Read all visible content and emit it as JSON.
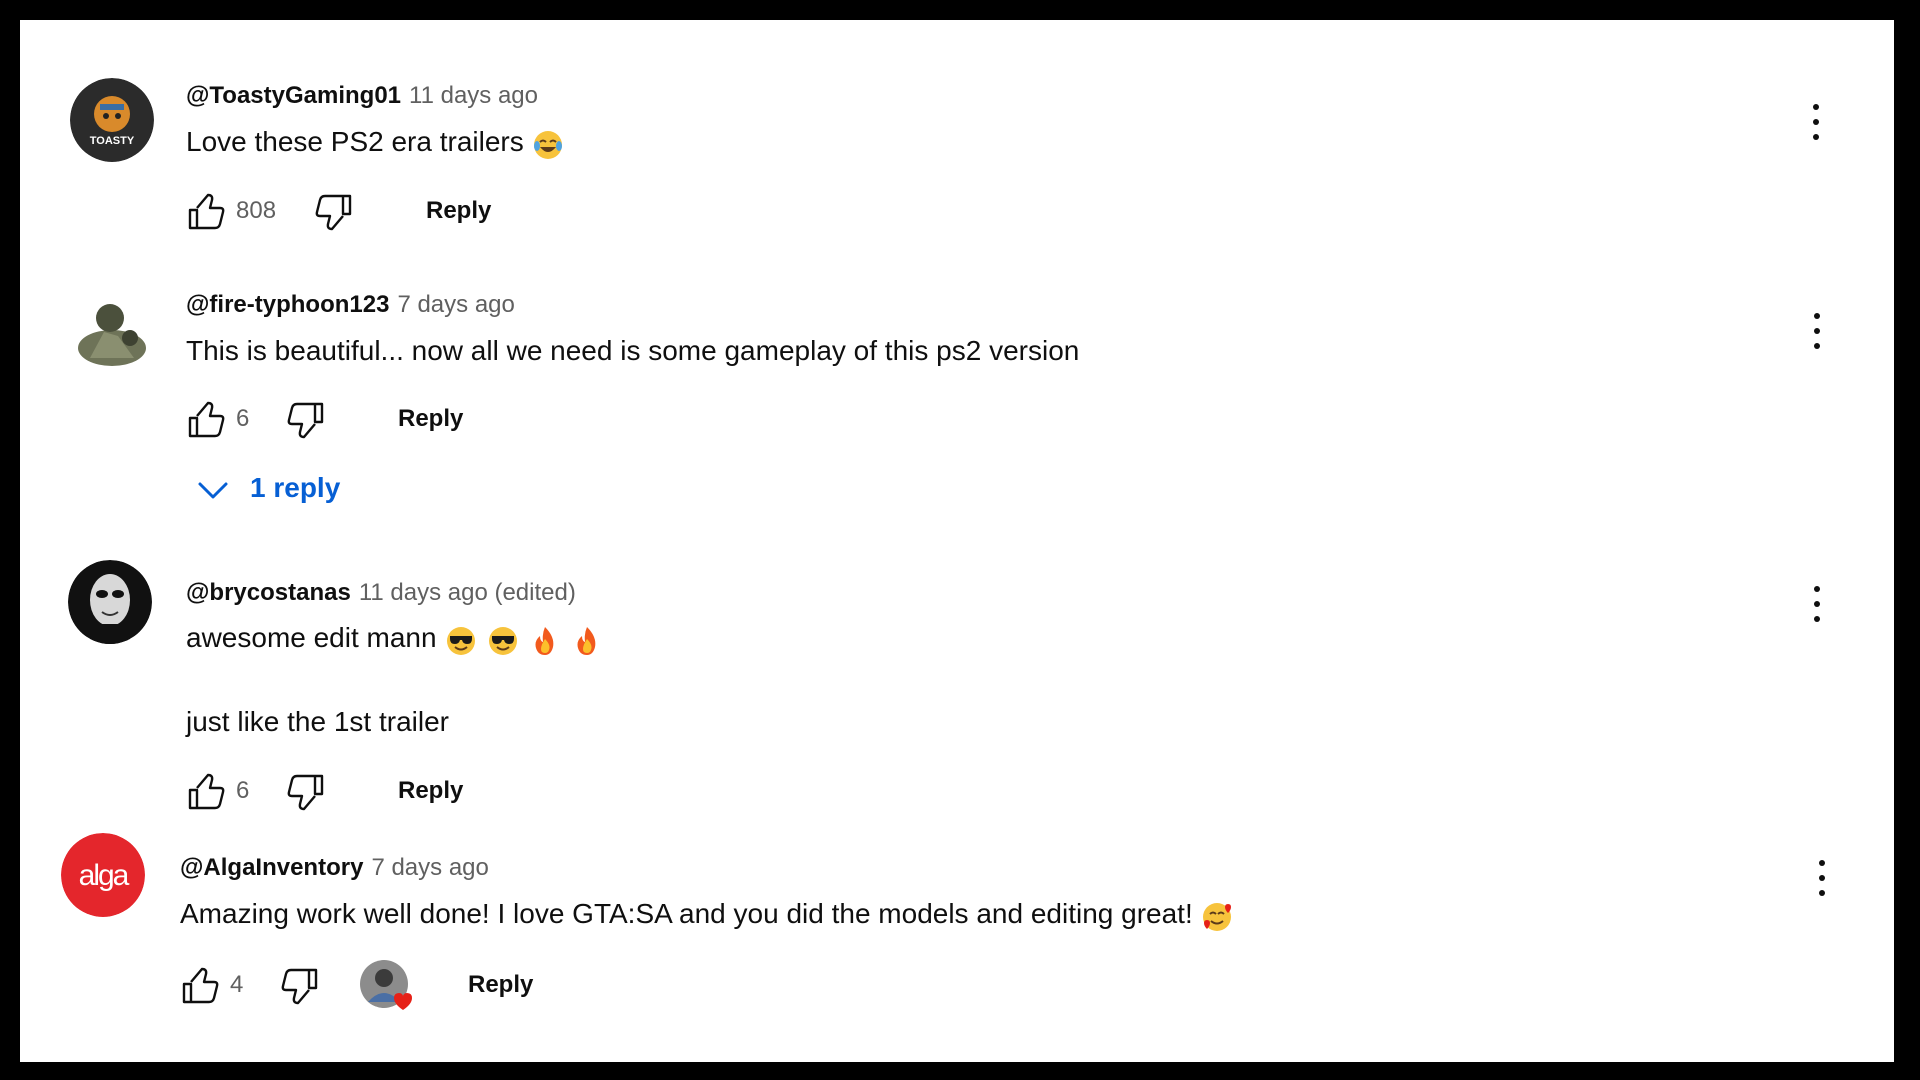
{
  "comments": [
    {
      "author": "@ToastyGaming01",
      "time": "11 days ago",
      "text": "Love these PS2 era trailers",
      "emojis": [
        "face-with-tears-of-joy"
      ],
      "likes": "808",
      "reply_label": "Reply",
      "avatar_text": "TOASTY",
      "avatar_color": "#2b2b2b"
    },
    {
      "author": "@fire-typhoon123",
      "time": "7 days ago",
      "text": "This is beautiful... now all we need is some gameplay of this ps2 version",
      "likes": "6",
      "reply_label": "Reply",
      "replies_label": "1 reply",
      "avatar_color": "#5a5f48"
    },
    {
      "author": "@brycostanas",
      "time": "11 days ago (edited)",
      "text": "awesome edit mann",
      "emojis": [
        "smiling-face-with-sunglasses",
        "smiling-face-with-sunglasses",
        "fire",
        "fire"
      ],
      "text2": "just like the 1st trailer",
      "likes": "6",
      "reply_label": "Reply",
      "avatar_color": "#111111"
    },
    {
      "author": "@AlgaInventory",
      "time": "7 days ago",
      "text": "Amazing work well done! I love GTA:SA and you did the models and editing great!",
      "emojis": [
        "smiling-face-with-hearts"
      ],
      "likes": "4",
      "reply_label": "Reply",
      "avatar_text": "alga",
      "avatar_color": "#e4262c",
      "creator_heart": true
    }
  ],
  "colors": {
    "link_blue": "#065fd4",
    "secondary_text": "#606060",
    "primary_text": "#0f0f0f",
    "heart_red": "#e62117"
  }
}
